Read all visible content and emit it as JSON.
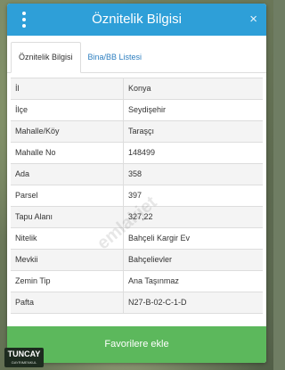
{
  "header": {
    "title": "Öznitelik Bilgisi",
    "close_symbol": "×",
    "menu_icon": "more-vertical-icon"
  },
  "tabs": [
    {
      "label": "Öznitelik Bilgisi",
      "active": true
    },
    {
      "label": "Bina/BB Listesi",
      "active": false
    }
  ],
  "attributes": [
    {
      "label": "İl",
      "value": "Konya"
    },
    {
      "label": "İlçe",
      "value": "Seydişehir"
    },
    {
      "label": "Mahalle/Köy",
      "value": "Taraşçı"
    },
    {
      "label": "Mahalle No",
      "value": "148499"
    },
    {
      "label": "Ada",
      "value": "358"
    },
    {
      "label": "Parsel",
      "value": "397"
    },
    {
      "label": "Tapu Alanı",
      "value": "327,22"
    },
    {
      "label": "Nitelik",
      "value": "Bahçeli Kargir Ev"
    },
    {
      "label": "Mevkii",
      "value": "Bahçelievler"
    },
    {
      "label": "Zemin Tip",
      "value": "Ana Taşınmaz"
    },
    {
      "label": "Pafta",
      "value": "N27-B-02-C-1-D"
    }
  ],
  "footer": {
    "favorite_label": "Favorilere ekle"
  },
  "watermark": "emlakjet",
  "logo": {
    "name": "TUNCAY",
    "subtitle": "GAYRIMENKUL"
  },
  "colors": {
    "header": "#2e9fd8",
    "favorite_button": "#5cb85c",
    "tab_link": "#2e7fc0"
  }
}
